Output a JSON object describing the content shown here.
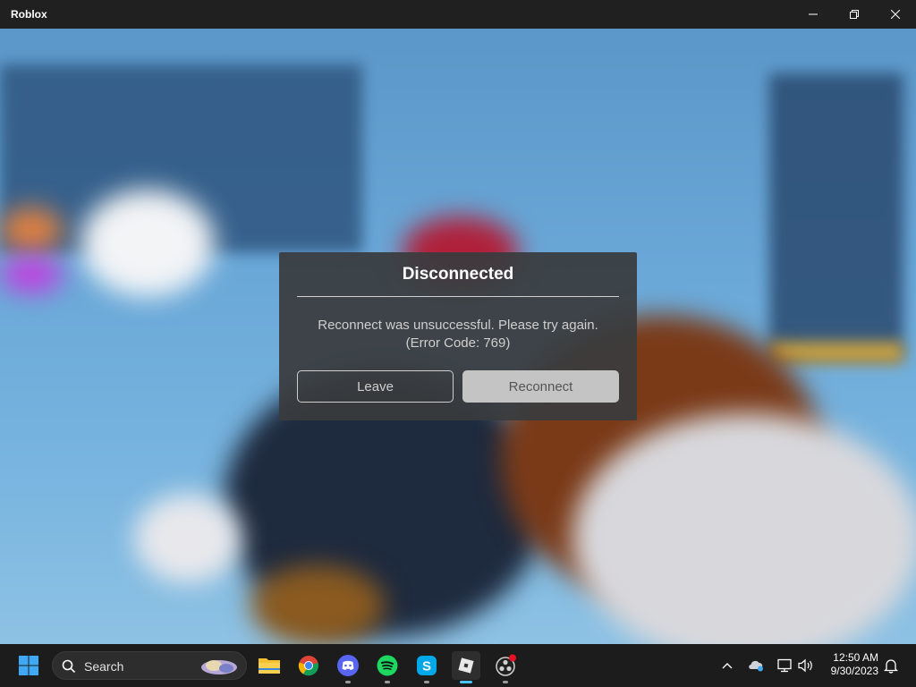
{
  "window": {
    "title": "Roblox"
  },
  "dialog": {
    "title": "Disconnected",
    "message_line1": "Reconnect was unsuccessful. Please try again.",
    "message_line2": "(Error Code: 769)",
    "leave_label": "Leave",
    "reconnect_label": "Reconnect"
  },
  "taskbar": {
    "search_placeholder": "Search",
    "apps": [
      "start-icon",
      "file-explorer-icon",
      "chrome-icon",
      "discord-icon",
      "spotify-icon",
      "skype-icon",
      "roblox-icon",
      "obs-icon"
    ],
    "time": "12:50 AM",
    "date": "9/30/2023"
  },
  "colors": {
    "dialog_bg": "#393b3d",
    "reconnect_bg": "#c4c4c4",
    "accent": "#4cc2ff"
  }
}
